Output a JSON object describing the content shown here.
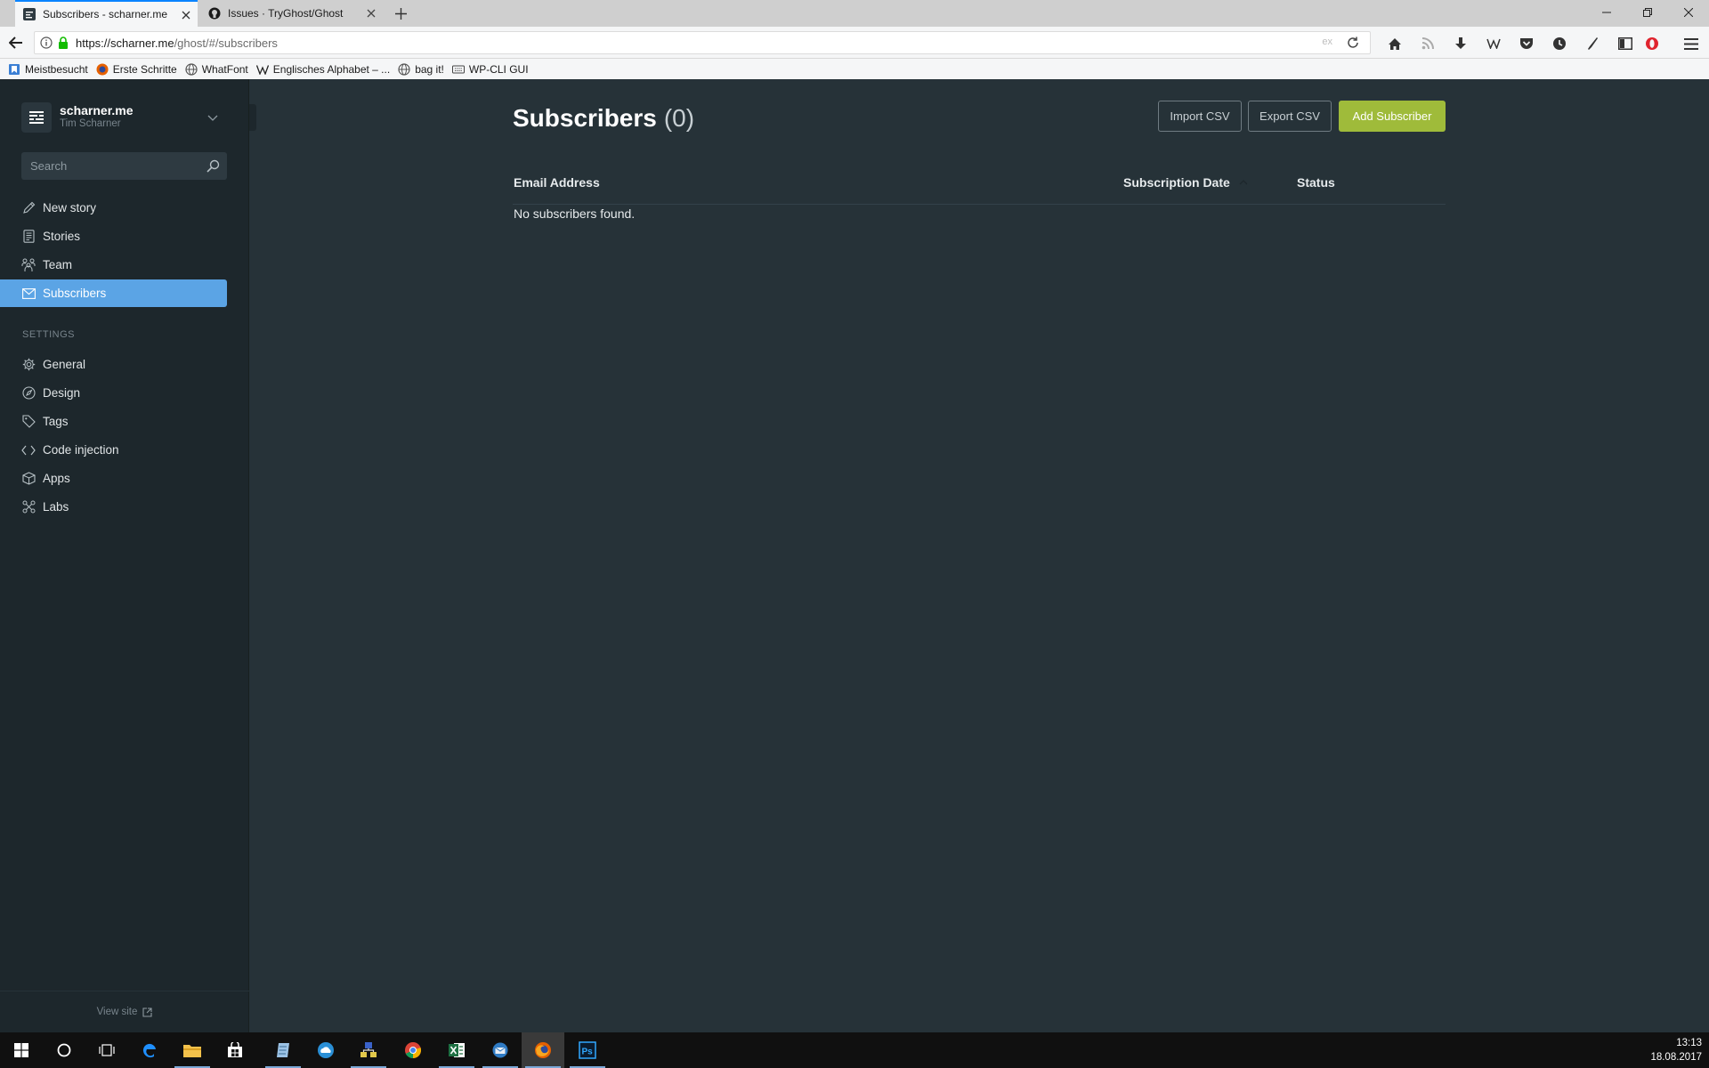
{
  "browser": {
    "tabs": [
      {
        "title": "Subscribers - scharner.me",
        "active": true,
        "icon": "ghost-favicon"
      },
      {
        "title": "Issues · TryGhost/Ghost",
        "active": false,
        "icon": "github-icon"
      }
    ],
    "url_host": "https://scharner.me",
    "url_path": "/ghost/#/subscribers",
    "reader_label": "ex",
    "bookmarks": [
      {
        "label": "Meistbesucht",
        "icon": "bookmark-folder-icon"
      },
      {
        "label": "Erste Schritte",
        "icon": "firefox-icon"
      },
      {
        "label": "WhatFont",
        "icon": "globe-icon"
      },
      {
        "label": "Englisches Alphabet – ...",
        "icon": "wikipedia-icon"
      },
      {
        "label": "bag it!",
        "icon": "globe-icon"
      },
      {
        "label": "WP-CLI GUI",
        "icon": "keyboard-icon"
      }
    ]
  },
  "sidebar": {
    "blog_title": "scharner.me",
    "user_name": "Tim Scharner",
    "search_placeholder": "Search",
    "nav": [
      {
        "label": "New story",
        "icon": "pencil-icon"
      },
      {
        "label": "Stories",
        "icon": "document-icon"
      },
      {
        "label": "Team",
        "icon": "team-icon"
      },
      {
        "label": "Subscribers",
        "icon": "mail-icon",
        "active": true
      }
    ],
    "settings_heading": "SETTINGS",
    "settings": [
      {
        "label": "General",
        "icon": "gear-icon"
      },
      {
        "label": "Design",
        "icon": "palette-icon"
      },
      {
        "label": "Tags",
        "icon": "tag-icon"
      },
      {
        "label": "Code injection",
        "icon": "code-icon"
      },
      {
        "label": "Apps",
        "icon": "box-icon"
      },
      {
        "label": "Labs",
        "icon": "labs-icon"
      }
    ],
    "view_site": "View site"
  },
  "main": {
    "title": "Subscribers",
    "count": "(0)",
    "buttons": {
      "import": "Import CSV",
      "export": "Export CSV",
      "add": "Add Subscriber"
    },
    "columns": [
      "Email Address",
      "Subscription Date",
      "Status"
    ],
    "empty_message": "No subscribers found."
  },
  "taskbar": {
    "time": "13:13",
    "date": "18.08.2017"
  },
  "colors": {
    "sidebar_bg": "#1d272c",
    "main_bg": "#263238",
    "active_nav": "#5ba4e5",
    "primary_button": "#9fbb3a"
  }
}
